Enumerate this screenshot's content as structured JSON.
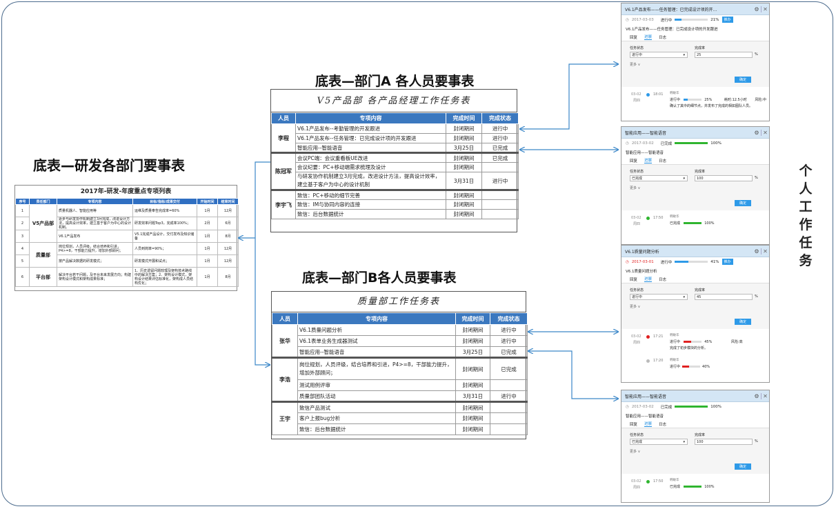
{
  "headings": {
    "overview": "底表—研发各部门要事表",
    "dept_a": "底表—部门A 各人员要事表",
    "dept_b": "底表—部门B各人员要事表",
    "personal": [
      "个",
      "人",
      "工",
      "作",
      "任",
      "务"
    ]
  },
  "overview": {
    "title": "2017年-研发-年度重点专项列表",
    "headers": [
      "序号",
      "责任部门",
      "专项内容",
      "目标/指标/成果交付",
      "开始时间",
      "结束时间"
    ],
    "rows": [
      {
        "no": "1",
        "dept": "",
        "content": "质量机器人、智能应用等",
        "target": "运维及质量奉告完成率=60%",
        "start": "1月",
        "end": "12月"
      },
      {
        "no": "2",
        "dept": "V5产品部",
        "content": "逐步与研发协作机制建立3月完成，改进设计方法，提高设计效率，建立基于客户为中心的设计机制。",
        "target": "研发效率问题Top3，完成率100%；",
        "start": "2月",
        "end": "6月"
      },
      {
        "no": "3",
        "dept": "",
        "content": "V6.1产品发布",
        "target": "V5.1完成产品设计，交付发布及知识储备",
        "start": "1月",
        "end": "8月"
      },
      {
        "no": "4",
        "dept": "质量部",
        "content": "岗位规划，人员评级，结合培养和引进，P4>=8，干部能力提升，增加外部顾问；",
        "target": "人员到岗率=90%；",
        "start": "1月",
        "end": "12月"
      },
      {
        "no": "5",
        "dept": "",
        "content": "按产品解决数据的研发模式；",
        "target": "研发模式开展和试点；",
        "start": "1月",
        "end": "12月"
      },
      {
        "no": "6",
        "dept": "平台部",
        "content": "解决平台若干问题，及平台未来发展方向；构建架构设计模式和架构成果标准；",
        "target": "1、历史遗留问题较理及架构技术路线中的解决方案；2、架构设计模式，架构设计结果评估标准化，架构成人员结构优化；",
        "start": "1月",
        "end": "8月"
      }
    ]
  },
  "dept_a": {
    "title": "V5产品部 各产品经理工作任务表",
    "headers": [
      "人员",
      "专项内容",
      "完成时间",
      "完成状态"
    ],
    "groups": [
      {
        "person": "李程",
        "rows": [
          {
            "content": "V6.1产品发布--考勤管理的开发跟进",
            "time": "封闭期间",
            "status": "进行中"
          },
          {
            "content": "V6.1产品发布--任务管理：已完成设计项的开发跟进",
            "time": "封闭期间",
            "status": "进行中"
          },
          {
            "content": "智能应用--智能语音",
            "time": "3月25日",
            "status": "已完成"
          }
        ]
      },
      {
        "person": "陈冠军",
        "rows": [
          {
            "content": "会议PC端：会议重看板UE改进",
            "time": "封闭期间",
            "status": "已完成"
          },
          {
            "content": "会议纪要：PC+移动端需求梳理及设计",
            "time": "封闭期间",
            "status": ""
          },
          {
            "content": "与研发协作机制建立3月完成，改进设计方法，提高设计效率，建立基于客户为中心的设计机制",
            "time": "3月31日",
            "status": "进行中"
          }
        ]
      },
      {
        "person": "李宇飞",
        "rows": [
          {
            "content": "致信：PC+移动的细节完善",
            "time": "封闭期间",
            "status": ""
          },
          {
            "content": "致信：IM与协同内容的连接",
            "time": "封闭期间",
            "status": ""
          },
          {
            "content": "致信：后台数据统计",
            "time": "封闭期间",
            "status": ""
          }
        ]
      }
    ]
  },
  "dept_b": {
    "title": "质量部工作任务表",
    "headers": [
      "人员",
      "专项内容",
      "完成时间",
      "完成状态"
    ],
    "groups": [
      {
        "person": "张华",
        "rows": [
          {
            "content": "V6.1质量问题分析",
            "time": "封闭期间",
            "status": "进行中"
          },
          {
            "content": "V6.1表单业务生成器测试",
            "time": "封闭期间",
            "status": "进行中"
          },
          {
            "content": "智能应用--智能语音",
            "time": "3月25日",
            "status": "已完成"
          }
        ]
      },
      {
        "person": "李浩",
        "rows": [
          {
            "content": "岗位规划，人员评级，结合培养和引进，P4>=8，干部能力提升，增加外部顾问；",
            "time": "封闭期间",
            "status": "已完成"
          },
          {
            "content": "测试用例评审",
            "time": "封闭期间",
            "status": ""
          },
          {
            "content": "质量部团队活动",
            "time": "3月31日",
            "status": "进行中"
          }
        ]
      },
      {
        "person": "王宇",
        "rows": [
          {
            "content": "致信产品测试",
            "time": "封闭期间",
            "status": ""
          },
          {
            "content": "客户上报bug分析",
            "time": "封闭期间",
            "status": ""
          },
          {
            "content": "致信：后台数据统计",
            "time": "封闭期间",
            "status": ""
          }
        ]
      }
    ]
  },
  "panels": [
    {
      "title": "V6.1产品发布——任务管理：已完成设计项的开...",
      "date": "2017-03-03",
      "date_red": false,
      "progress_label": "进行中",
      "progress": 21,
      "progress_text": "21%",
      "bar_color": "#2e9ae8",
      "btn": "推办",
      "subtitle": "V6.1产品发布——任务管理：已完成设计项的开发跟进",
      "tabs": [
        "回复",
        "进展",
        "日志"
      ],
      "state_label": "任务状态",
      "state": "进行中",
      "rate_label": "完成率",
      "rate": "25",
      "pct": "%",
      "more": "更多",
      "confirm": "确定",
      "log_date": "03-02",
      "log_day": "周四",
      "log_time": "18:01",
      "log_who": "韩敏华",
      "log_dot": "#2e9ae8",
      "log_line1": "进行中",
      "log_pct": "25%",
      "log_extra": "耗时:12.5小时",
      "log_risk": "风险:中",
      "log_line2": "确认了其中的细节点，并发布了完成的相如图队人员。"
    },
    {
      "title": "智能应用——智能语音",
      "date": "2017-03-02",
      "date_red": false,
      "progress_label": "已完成",
      "progress": 100,
      "progress_text": "100%",
      "bar_color": "#2fb52f",
      "btn": "",
      "subtitle": "智能应用——智能语音",
      "tabs": [
        "回复",
        "进展",
        "日志"
      ],
      "state_label": "任务状态",
      "state": "已完成",
      "rate_label": "完成率",
      "rate": "100",
      "pct": "%",
      "more": "更多",
      "confirm": "确定",
      "log_date": "03-02",
      "log_day": "周四",
      "log_time": "17:50",
      "log_who": "韩敏华",
      "log_dot": "#2fb52f",
      "log_line1": "已完成",
      "log_pct": "100%",
      "log_extra": "",
      "log_risk": "",
      "log_line2": ""
    },
    {
      "title": "V6.1质量问题分析",
      "date": "2017-03-01",
      "date_red": true,
      "progress_label": "进行中",
      "progress": 41,
      "progress_text": "41%",
      "bar_color": "#2e9ae8",
      "btn": "推办",
      "subtitle": "V6.1质量问题分析",
      "tabs": [
        "回复",
        "进展",
        "日志"
      ],
      "state_label": "任务状态",
      "state": "进行中",
      "rate_label": "完成率",
      "rate": "45",
      "pct": "%",
      "more": "更多",
      "confirm": "确定",
      "log_date": "03-02",
      "log_day": "周四",
      "log_time": "17:21",
      "log_who": "韩敏华",
      "log_dot": "#e02020",
      "log_line1": "进行中",
      "log_pct": "45%",
      "log_extra": "",
      "log_risk": "风险:高",
      "log_line2": "完成了初步模块的分析。",
      "log2_time": "17:20",
      "log2_who": "韩敏华",
      "log2_line": "进行中",
      "log2_pct": "40%"
    },
    {
      "title": "智能应用——智能语音",
      "date": "2017-03-02",
      "date_red": false,
      "progress_label": "已完成",
      "progress": 100,
      "progress_text": "100%",
      "bar_color": "#2fb52f",
      "btn": "",
      "subtitle": "智能应用——智能语音",
      "tabs": [
        "回复",
        "进展",
        "日志"
      ],
      "state_label": "任务状态",
      "state": "已完成",
      "rate_label": "完成率",
      "rate": "100",
      "pct": "%",
      "more": "更多",
      "confirm": "确定",
      "log_date": "03-02",
      "log_day": "周四",
      "log_time": "17:50",
      "log_who": "韩敏华",
      "log_dot": "#2fb52f",
      "log_line1": "已完成",
      "log_pct": "100%",
      "log_extra": "",
      "log_risk": "",
      "log_line2": ""
    }
  ]
}
